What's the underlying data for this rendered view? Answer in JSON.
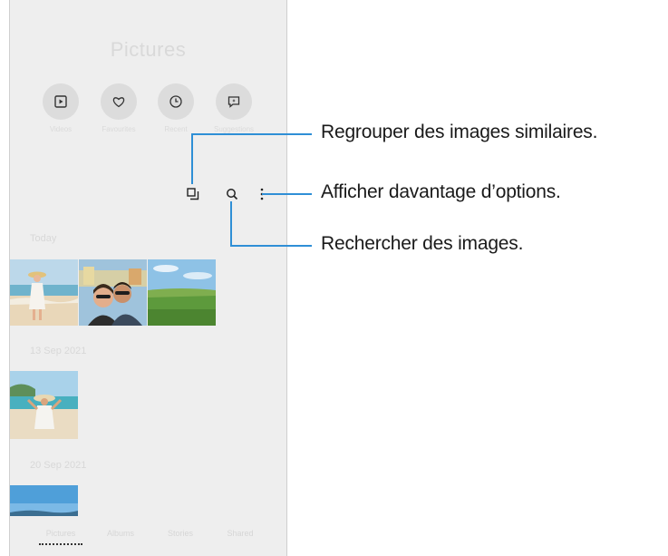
{
  "app": {
    "title": "Pictures"
  },
  "quick_actions": [
    {
      "label": "Videos",
      "icon": "play-box-icon"
    },
    {
      "label": "Favourites",
      "icon": "heart-icon"
    },
    {
      "label": "Recent",
      "icon": "clock-icon"
    },
    {
      "label": "Suggestions",
      "icon": "sparkle-chat-icon"
    }
  ],
  "toolbar": {
    "group_icon": "group-similar-icon",
    "search_icon": "search-icon",
    "more_icon": "more-options-icon"
  },
  "sections": [
    {
      "date": "Today"
    },
    {
      "date": "13 Sep 2021"
    },
    {
      "date": "20 Sep 2021"
    }
  ],
  "bottom_nav": {
    "tabs": [
      "Pictures",
      "Albums",
      "Stories",
      "Shared"
    ],
    "selected": "Pictures"
  },
  "callouts": {
    "group_similar": "Regrouper des images similaires.",
    "more_options": "Afficher davantage d’options.",
    "search": "Rechercher des images."
  },
  "colors": {
    "callout_line": "#2f8fd6",
    "screen_bg": "#eeeeee"
  }
}
